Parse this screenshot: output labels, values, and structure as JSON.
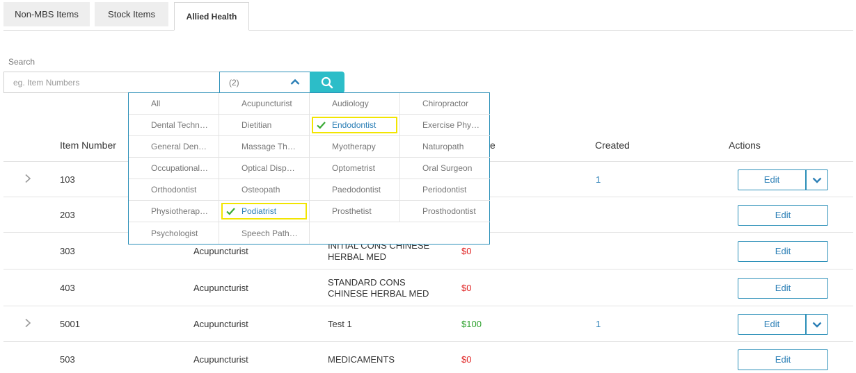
{
  "tabs": [
    {
      "label": "Non-MBS Items"
    },
    {
      "label": "Stock Items"
    },
    {
      "label": "Allied Health"
    }
  ],
  "search": {
    "label": "Search",
    "placeholder": "eg. Item Numbers",
    "value": "",
    "filter_display": "(2)"
  },
  "dropdown": {
    "options": [
      {
        "label": "All",
        "selected": false
      },
      {
        "label": "Acupuncturist",
        "selected": false
      },
      {
        "label": "Audiology",
        "selected": false
      },
      {
        "label": "Chiropractor",
        "selected": false
      },
      {
        "label": "Dental Techn…",
        "selected": false
      },
      {
        "label": "Dietitian",
        "selected": false
      },
      {
        "label": "Endodontist",
        "selected": true
      },
      {
        "label": "Exercise Phy…",
        "selected": false
      },
      {
        "label": "General Den…",
        "selected": false
      },
      {
        "label": "Massage Th…",
        "selected": false
      },
      {
        "label": "Myotherapy",
        "selected": false
      },
      {
        "label": "Naturopath",
        "selected": false
      },
      {
        "label": "Occupational…",
        "selected": false
      },
      {
        "label": "Optical Disp…",
        "selected": false
      },
      {
        "label": "Optometrist",
        "selected": false
      },
      {
        "label": "Oral Surgeon",
        "selected": false
      },
      {
        "label": "Orthodontist",
        "selected": false
      },
      {
        "label": "Osteopath",
        "selected": false
      },
      {
        "label": "Paedodontist",
        "selected": false
      },
      {
        "label": "Periodontist",
        "selected": false
      },
      {
        "label": "Physiotherap…",
        "selected": false
      },
      {
        "label": "Podiatrist",
        "selected": true
      },
      {
        "label": "Prosthetist",
        "selected": false
      },
      {
        "label": "Prosthodontist",
        "selected": false
      },
      {
        "label": "Psychologist",
        "selected": false
      },
      {
        "label": "Speech Path…",
        "selected": false
      }
    ]
  },
  "table": {
    "headers": {
      "item_number": "Item Number",
      "price_partial": "e",
      "created": "Created",
      "actions": "Actions"
    },
    "edit_label": "Edit",
    "rows": [
      {
        "item": "103",
        "category": "",
        "desc1": "",
        "desc2": "",
        "price": "",
        "price_color": "",
        "created": "1",
        "expandable": true,
        "split": true
      },
      {
        "item": "203",
        "category": "",
        "desc1": "",
        "desc2": "",
        "price": "",
        "price_color": "",
        "created": "",
        "expandable": false,
        "split": false
      },
      {
        "item": "303",
        "category": "Acupuncturist",
        "desc1": "INITIAL CONS CHINESE",
        "desc2": "HERBAL MED",
        "price": "$0",
        "price_color": "red",
        "created": "",
        "expandable": false,
        "split": false
      },
      {
        "item": "403",
        "category": "Acupuncturist",
        "desc1": "STANDARD CONS",
        "desc2": "CHINESE HERBAL MED",
        "price": "$0",
        "price_color": "red",
        "created": "",
        "expandable": false,
        "split": false
      },
      {
        "item": "5001",
        "category": "Acupuncturist",
        "desc1": "Test 1",
        "desc2": "",
        "price": "$100",
        "price_color": "green",
        "created": "1",
        "expandable": true,
        "split": true
      },
      {
        "item": "503",
        "category": "Acupuncturist",
        "desc1": "MEDICAMENTS",
        "desc2": "",
        "price": "$0",
        "price_color": "red",
        "created": "",
        "expandable": false,
        "split": false
      }
    ]
  },
  "colors": {
    "accent": "#2b8fb8",
    "search_button": "#2cbdc8",
    "price_zero": "#e02424",
    "price_positive": "#2ca02c",
    "highlight": "#f2e500"
  }
}
